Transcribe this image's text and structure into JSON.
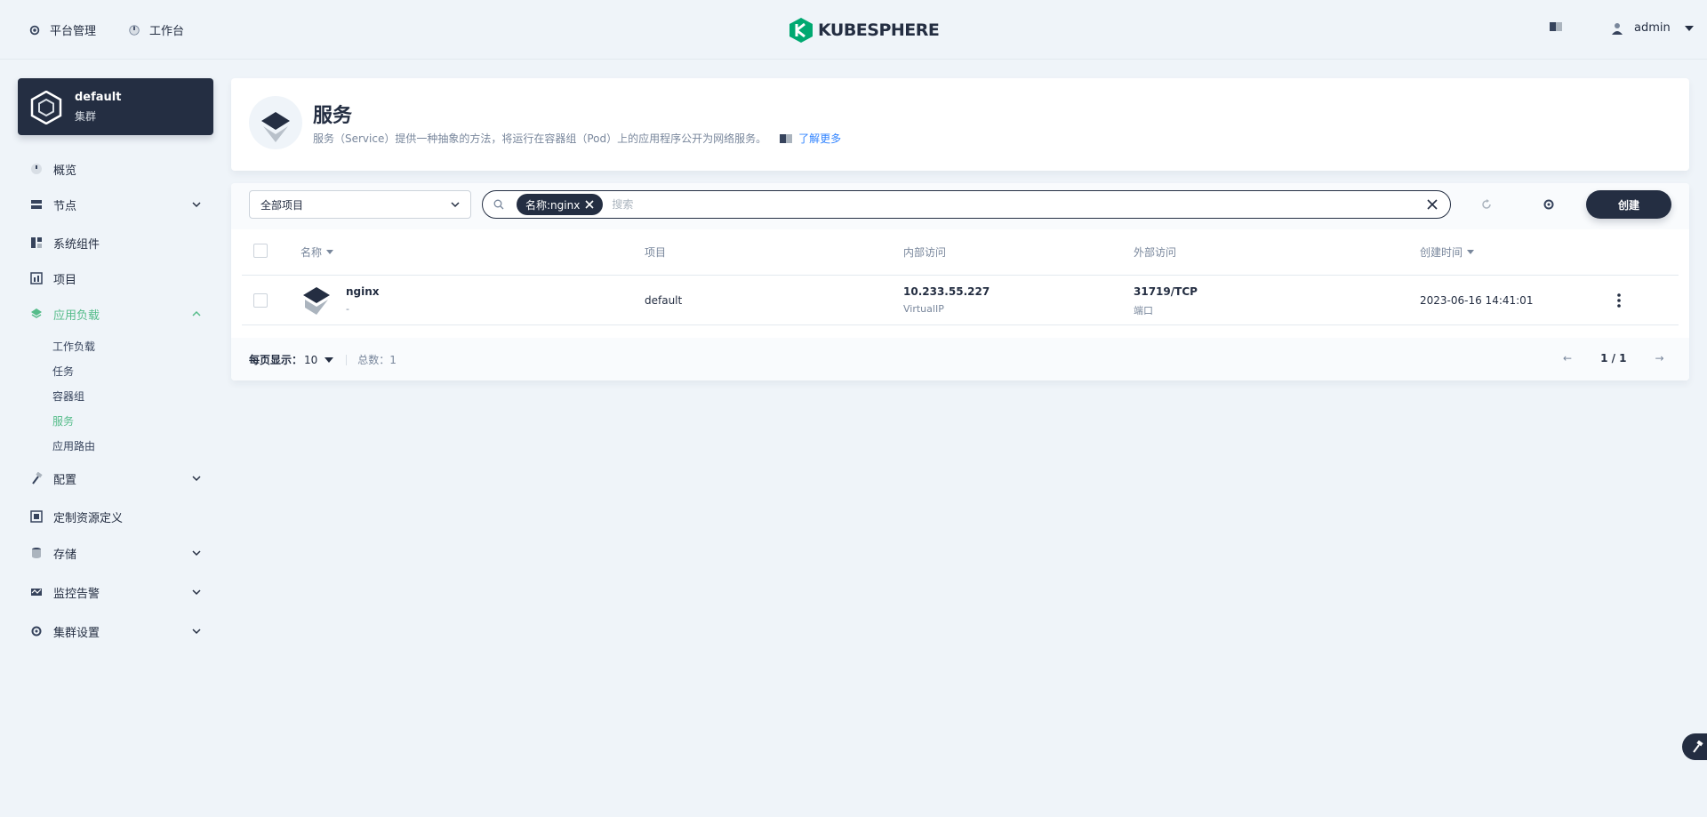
{
  "topbar": {
    "platform_label": "平台管理",
    "workbench_label": "工作台",
    "logo_text": "KUBESPHERE",
    "user_name": "admin"
  },
  "cluster": {
    "name": "default",
    "subtitle": "集群"
  },
  "sidebar": {
    "items": [
      {
        "label": "概览",
        "icon": "dashboard-icon"
      },
      {
        "label": "节点",
        "icon": "server-icon"
      },
      {
        "label": "系统组件",
        "icon": "components-icon"
      },
      {
        "label": "项目",
        "icon": "project-icon"
      },
      {
        "label": "应用负载",
        "icon": "layers-icon"
      },
      {
        "label": "配置",
        "icon": "hammer-icon"
      },
      {
        "label": "定制资源定义",
        "icon": "crd-icon"
      },
      {
        "label": "存储",
        "icon": "database-icon"
      },
      {
        "label": "监控告警",
        "icon": "monitor-icon"
      },
      {
        "label": "集群设置",
        "icon": "gear-icon"
      }
    ],
    "sub_items": [
      "工作负载",
      "任务",
      "容器组",
      "服务",
      "应用路由"
    ]
  },
  "header": {
    "title": "服务",
    "description": "服务（Service）提供一种抽象的方法，将运行在容器组（Pod）上的应用程序公开为网络服务。",
    "learn_more": "了解更多"
  },
  "toolbar": {
    "project_select": "全部项目",
    "search_tag": "名称:nginx",
    "search_placeholder": "搜索",
    "create_label": "创建"
  },
  "table": {
    "columns": [
      "名称",
      "项目",
      "内部访问",
      "外部访问",
      "创建时间"
    ],
    "rows": [
      {
        "name": "nginx",
        "name_sub": "-",
        "project": "default",
        "internal": "10.233.55.227",
        "internal_sub": "VirtualIP",
        "external": "31719/TCP",
        "external_sub": "端口",
        "created": "2023-06-16 14:41:01"
      }
    ]
  },
  "footer": {
    "page_size_label": "每页显示：",
    "page_size": "10",
    "total_label": "总数：1",
    "page": "1 / 1"
  },
  "colors": {
    "accent": "#55bc8a",
    "dark": "#242e42",
    "link": "#3385ff"
  }
}
